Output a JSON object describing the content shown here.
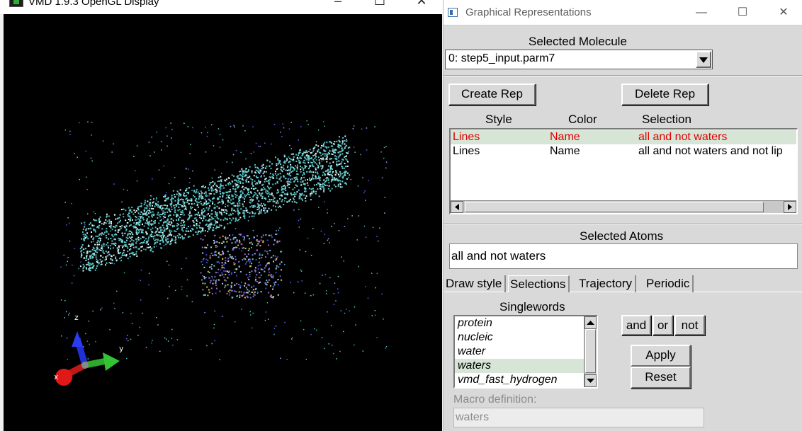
{
  "gl_window": {
    "title": "VMD 1.9.3 OpenGL Display",
    "minimize_glyph": "–",
    "maximize_glyph": "☐",
    "close_glyph": "✕",
    "axes": {
      "x": "x",
      "y": "y",
      "z": "z"
    },
    "colors": {
      "background": "#000000",
      "membrane": "#58c8c8",
      "x_axis": "#e01818",
      "y_axis": "#2ea82e",
      "z_axis": "#2030d8"
    }
  },
  "rep_window": {
    "title": "Graphical Representations",
    "minimize_glyph": "—",
    "maximize_glyph": "☐",
    "close_glyph": "✕",
    "selected_molecule_label": "Selected Molecule",
    "selected_molecule_value": "0: step5_input.parm7",
    "create_rep_label": "Create Rep",
    "delete_rep_label": "Delete Rep",
    "columns": {
      "style": "Style",
      "color": "Color",
      "selection": "Selection"
    },
    "reps": [
      {
        "style": "Lines",
        "color": "Name",
        "selection": "all and not waters",
        "selected": true
      },
      {
        "style": "Lines",
        "color": "Name",
        "selection": "all and not waters and not lip",
        "selected": false
      }
    ],
    "selected_atoms_label": "Selected Atoms",
    "selected_atoms_value": "all and not waters",
    "tabs": [
      "Draw style",
      "Selections",
      "Trajectory",
      "Periodic"
    ],
    "active_tab": "Selections",
    "singlewords_label": "Singlewords",
    "singlewords": [
      "protein",
      "nucleic",
      "water",
      "waters",
      "vmd_fast_hydrogen"
    ],
    "selected_singleword": "waters",
    "and_label": "and",
    "or_label": "or",
    "not_label": "not",
    "apply_label": "Apply",
    "reset_label": "Reset",
    "macro_label": "Macro definition:",
    "macro_value": "waters",
    "colors": {
      "selected_row_bg": "#d7e5d7",
      "selected_row_text": "#e00000",
      "panel_bg": "#d9d9d9"
    }
  }
}
